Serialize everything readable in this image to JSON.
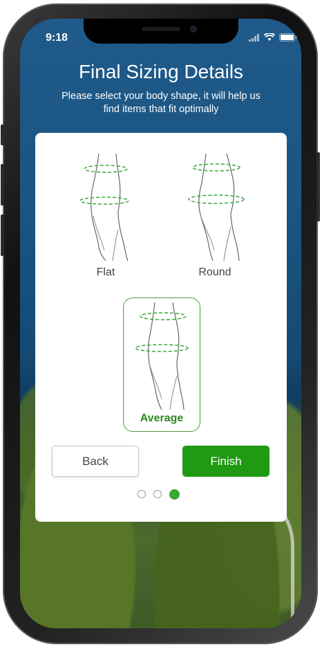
{
  "status_bar": {
    "time": "9:18"
  },
  "header": {
    "title": "Final Sizing Details",
    "subtitle": "Please select your body shape, it will help us find items that fit optimally"
  },
  "shapes": [
    {
      "label": "Flat",
      "selected": false
    },
    {
      "label": "Round",
      "selected": false
    },
    {
      "label": "Average",
      "selected": true
    }
  ],
  "actions": {
    "back_label": "Back",
    "finish_label": "Finish"
  },
  "pagination": {
    "total": 3,
    "current": 3
  },
  "colors": {
    "accent": "#1f9a12",
    "selected_text": "#2b8a1f",
    "waist_line": "#3aa832"
  }
}
